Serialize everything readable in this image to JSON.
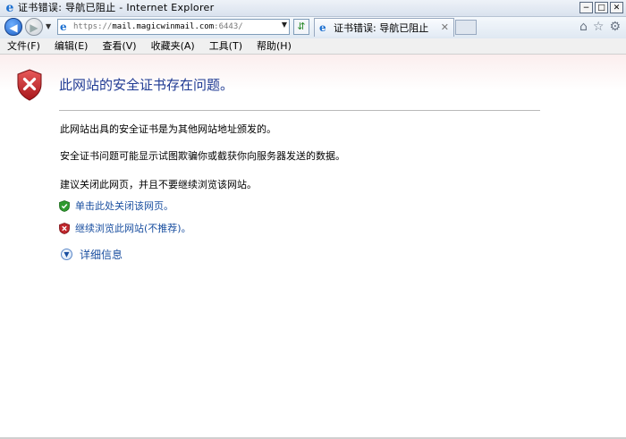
{
  "window": {
    "title": "证书错误: 导航已阻止 - Internet Explorer",
    "controls": [
      "minimize-icon",
      "maximize-icon",
      "close-icon"
    ]
  },
  "navbar": {
    "address_prefix": "https://",
    "address_host": "mail.magicwinmail.com",
    "address_port": ":6443/",
    "tab_title": "证书错误: 导航已阻止",
    "icons": [
      "back-icon",
      "forward-icon",
      "refresh-icon",
      "home-icon",
      "favorites-icon",
      "tools-icon"
    ]
  },
  "menu": {
    "items": [
      "文件(F)",
      "编辑(E)",
      "查看(V)",
      "收藏夹(A)",
      "工具(T)",
      "帮助(H)"
    ]
  },
  "page": {
    "heading": "此网站的安全证书存在问题。",
    "para1": "此网站出具的安全证书是为其他网站地址颁发的。",
    "para2": "安全证书问题可能显示试图欺骗你或截获你向服务器发送的数据。",
    "para3": "建议关闭此网页，并且不要继续浏览该网站。",
    "close_link": "单击此处关闭该网页。",
    "continue_link": "继续浏览此网站(不推荐)。",
    "details": "详细信息",
    "colors": {
      "accent": "#1a4fa0",
      "error": "#c0272d",
      "ok": "#2e9a2e"
    }
  }
}
